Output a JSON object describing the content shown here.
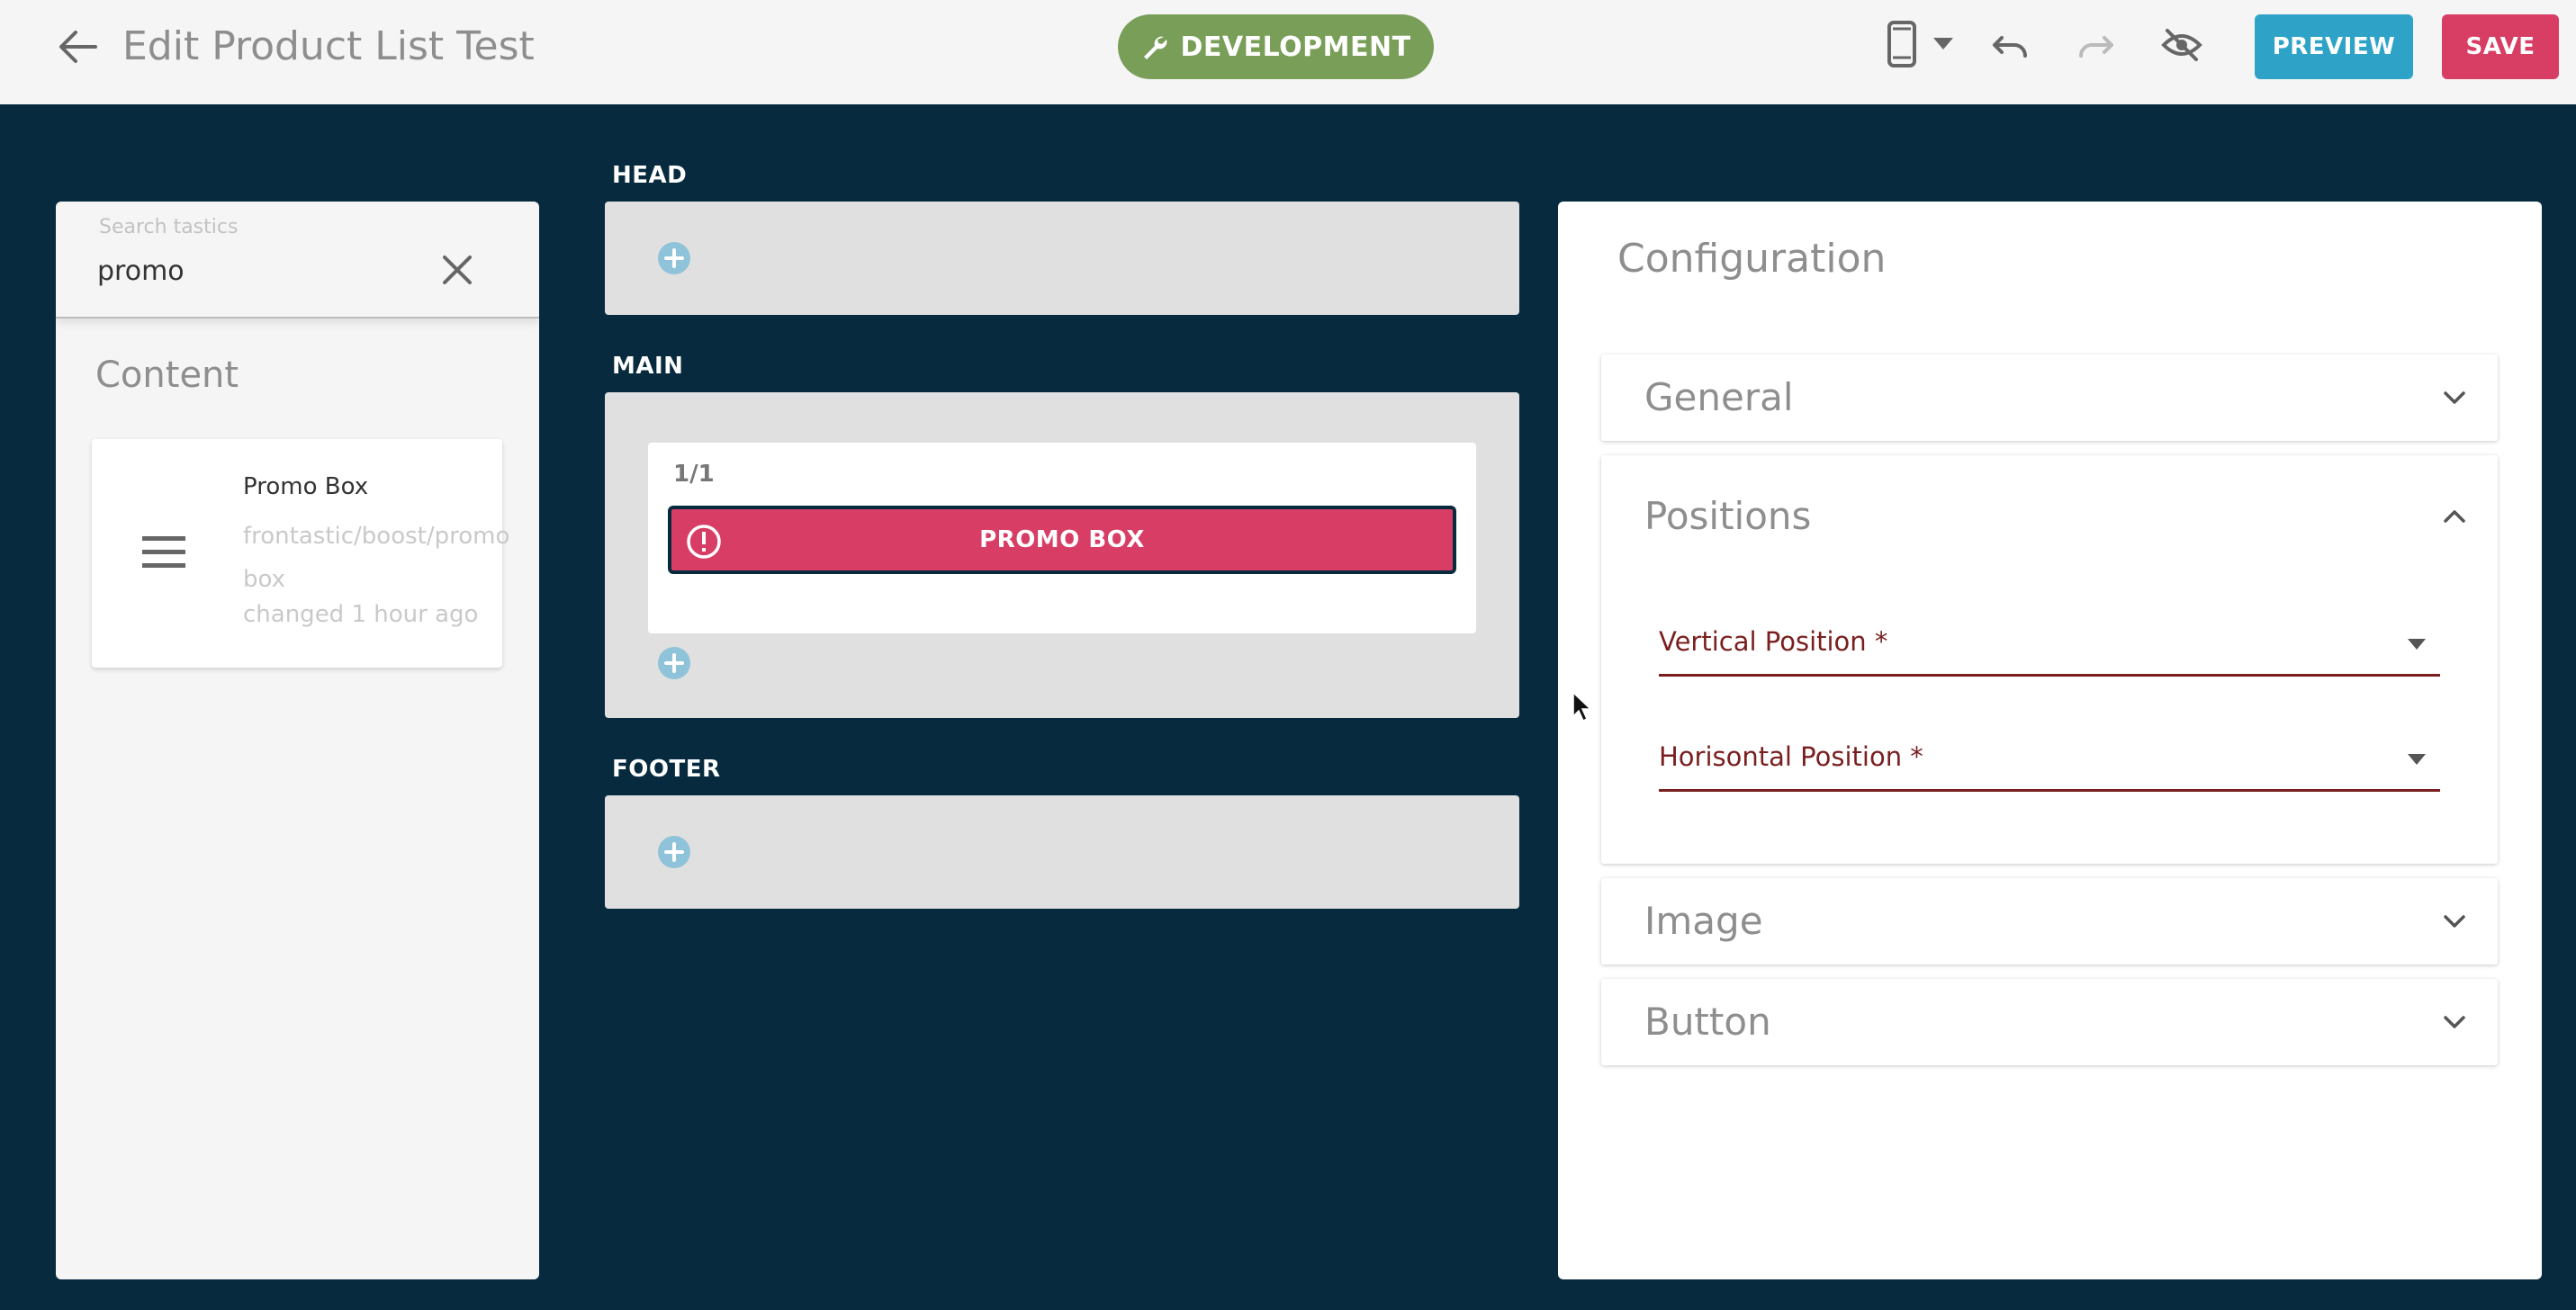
{
  "header": {
    "title": "Edit Product List Test",
    "environment": "DEVELOPMENT",
    "device_icon": "smartphone-icon",
    "preview_label": "PREVIEW",
    "save_label": "SAVE"
  },
  "sidebar": {
    "search": {
      "label": "Search tastics",
      "value": "promo"
    },
    "section_title": "Content",
    "tastics": [
      {
        "name": "Promo Box",
        "path": "frontastic/boost/promo box",
        "changed": "changed 1 hour ago"
      }
    ]
  },
  "stage": {
    "regions": [
      {
        "label": "HEAD"
      },
      {
        "label": "MAIN",
        "cell": {
          "label": "1/1",
          "tastic": "PROMO BOX"
        }
      },
      {
        "label": "FOOTER"
      }
    ]
  },
  "config": {
    "title": "Configuration",
    "sections": [
      {
        "title": "General",
        "expanded": false
      },
      {
        "title": "Positions",
        "expanded": true,
        "fields": [
          {
            "label": "Vertical Position *"
          },
          {
            "label": "Horisontal Position *"
          }
        ]
      },
      {
        "title": "Image",
        "expanded": false
      },
      {
        "title": "Button",
        "expanded": false
      }
    ]
  },
  "colors": {
    "background": "#072a3e",
    "environment_badge": "#789e58",
    "preview_button": "#2fa3c7",
    "save_button": "#d83d64",
    "promo_tastic": "#d73d65",
    "required_field": "#7a1f1f"
  }
}
